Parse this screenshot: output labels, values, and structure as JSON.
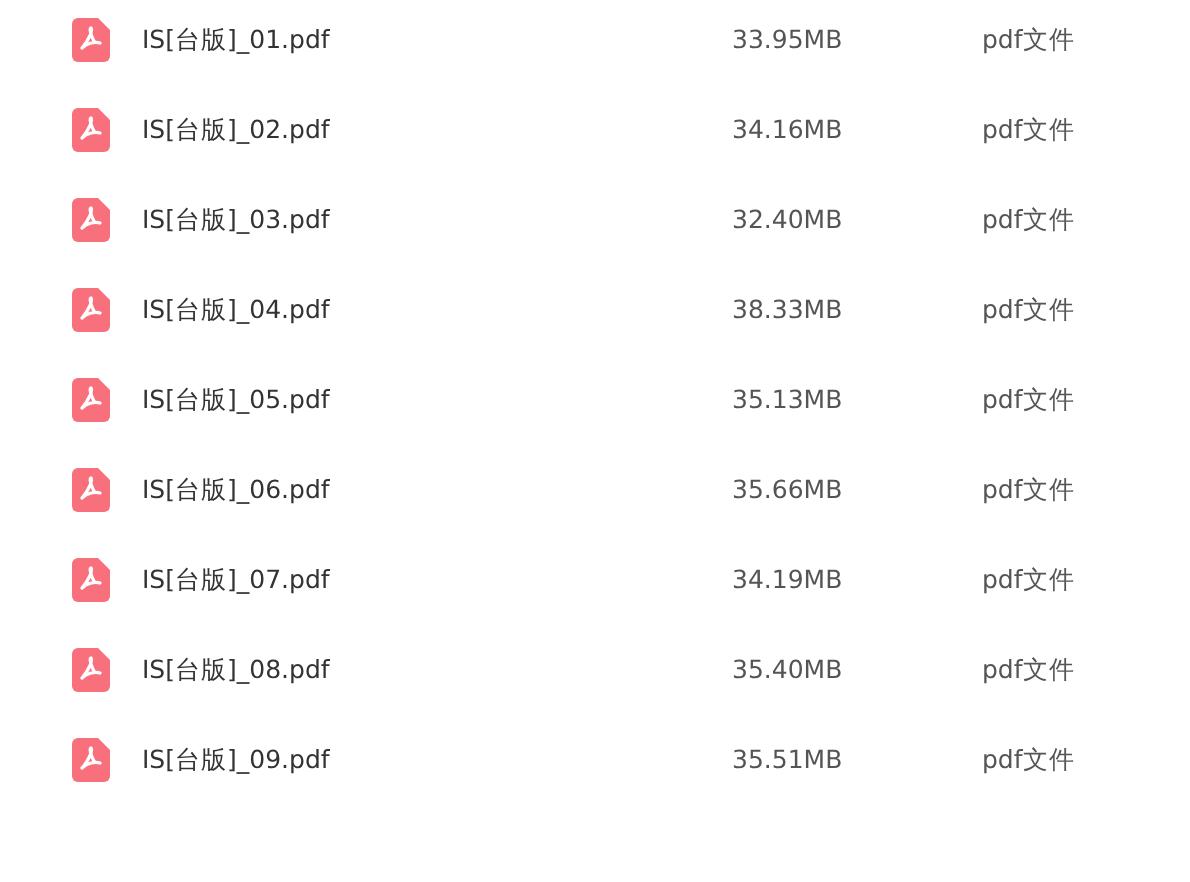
{
  "files": [
    {
      "name": "IS[台版]_01.pdf",
      "size": "33.95MB",
      "type": "pdf文件"
    },
    {
      "name": "IS[台版]_02.pdf",
      "size": "34.16MB",
      "type": "pdf文件"
    },
    {
      "name": "IS[台版]_03.pdf",
      "size": "32.40MB",
      "type": "pdf文件"
    },
    {
      "name": "IS[台版]_04.pdf",
      "size": "38.33MB",
      "type": "pdf文件"
    },
    {
      "name": "IS[台版]_05.pdf",
      "size": "35.13MB",
      "type": "pdf文件"
    },
    {
      "name": "IS[台版]_06.pdf",
      "size": "35.66MB",
      "type": "pdf文件"
    },
    {
      "name": "IS[台版]_07.pdf",
      "size": "34.19MB",
      "type": "pdf文件"
    },
    {
      "name": "IS[台版]_08.pdf",
      "size": "35.40MB",
      "type": "pdf文件"
    },
    {
      "name": "IS[台版]_09.pdf",
      "size": "35.51MB",
      "type": "pdf文件"
    }
  ]
}
